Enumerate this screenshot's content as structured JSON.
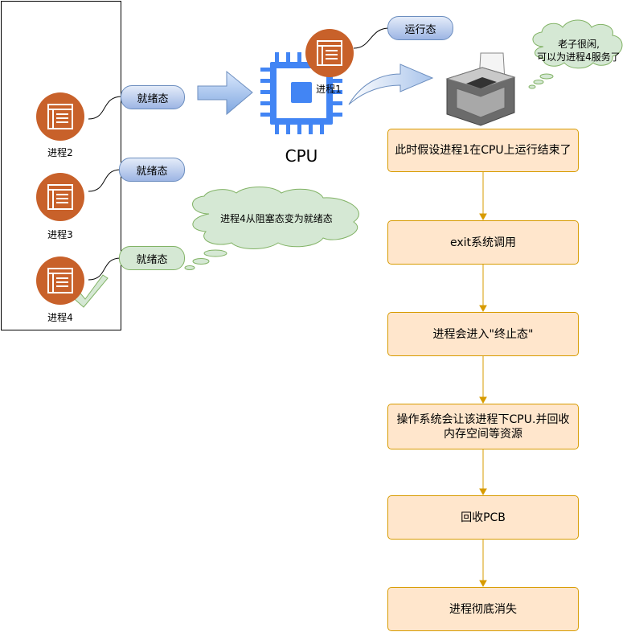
{
  "processes": [
    {
      "label": "进程2",
      "state": "就绪态"
    },
    {
      "label": "进程3",
      "state": "就绪态"
    },
    {
      "label": "进程4",
      "state": "就绪态"
    }
  ],
  "cpu": {
    "label": "CPU",
    "process_label": "进程1",
    "state": "运行态"
  },
  "clouds": {
    "printer_note": {
      "line1": "老子很闲,",
      "line2": "可以为进程4服务了"
    },
    "blocked_note": "进程4从阻塞态变为就绪态"
  },
  "steps": [
    "此时假设进程1在CPU上运行结束了",
    "exit系统调用",
    "进程会进入\"终止态\"",
    "操作系统会让该进程下CPU.并回收内存空间等资源",
    "回收PCB",
    "进程彻底消失"
  ],
  "colors": {
    "process_circle": "#c8612a",
    "cpu_blue": "#4285f4",
    "step_fill": "#ffe6cc",
    "step_border": "#d79b00",
    "ready_pill": "#9db5e4",
    "green_pill": "#d5e8d4"
  }
}
